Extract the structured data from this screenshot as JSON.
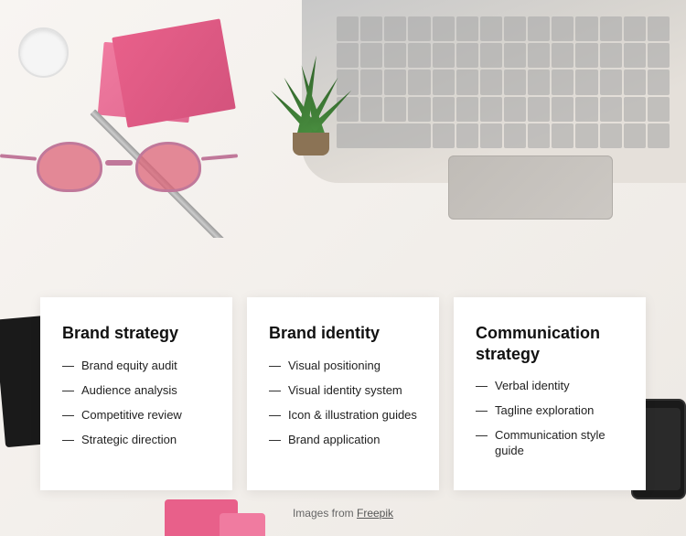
{
  "background": {
    "alt": "Desk flatlay with laptop, plant, glasses, and office supplies"
  },
  "cards": [
    {
      "id": "brand-strategy",
      "title": "Brand strategy",
      "items": [
        "Brand equity audit",
        "Audience analysis",
        "Competitive review",
        "Strategic direction"
      ]
    },
    {
      "id": "brand-identity",
      "title": "Brand identity",
      "items": [
        "Visual positioning",
        "Visual identity system",
        "Icon & illustration guides",
        "Brand application"
      ]
    },
    {
      "id": "communication-strategy",
      "title": "Communication strategy",
      "items": [
        "Verbal identity",
        "Tagline exploration",
        "Communication style guide"
      ]
    }
  ],
  "footer": {
    "text": "Images from ",
    "link_text": "Freepik",
    "link_url": "#"
  },
  "decorative": {
    "dash": "—"
  }
}
